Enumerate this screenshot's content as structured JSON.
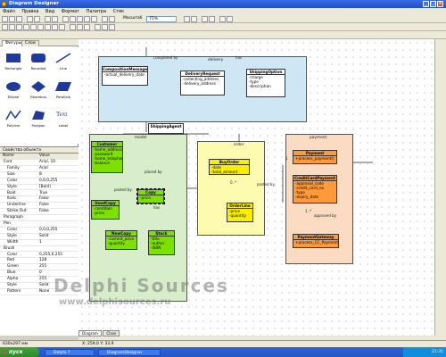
{
  "window": {
    "title": "Diagram Designer"
  },
  "menu": [
    "Файл",
    "Правка",
    "Вид",
    "Формат",
    "Палитра",
    "Стек"
  ],
  "toolbar": {
    "zoom_label": "Масштаб",
    "zoom_value": "75%"
  },
  "panel_tabs": [
    "Фигуры",
    "Слои"
  ],
  "shapes": [
    "Rectangle",
    "Rounded",
    "Line",
    "Ellipse",
    "Rhombus",
    "Parallelo",
    "Polyline",
    "Polygon",
    "Label"
  ],
  "shape_text_glyph": "Text",
  "properties": {
    "title": "Свойства объекта",
    "columns": [
      "Name",
      "Value"
    ],
    "rows": [
      [
        "Font",
        "Arial, 10"
      ],
      [
        "Family",
        "Arial"
      ],
      [
        "Size",
        "8"
      ],
      [
        "Color",
        "0,0,0,255"
      ],
      [
        "Style",
        "[Bold]"
      ],
      [
        "Bold",
        "True"
      ],
      [
        "Italic",
        "False"
      ],
      [
        "Underline",
        "False"
      ],
      [
        "Strike Out",
        "False"
      ],
      [
        "Paragraph",
        ""
      ],
      [
        "Pen",
        ""
      ],
      [
        "Color",
        "0,0,0,255"
      ],
      [
        "Style",
        "Solid"
      ],
      [
        "Width",
        "1"
      ],
      [
        "Brush",
        ""
      ],
      [
        "Color",
        "0,255,0,255"
      ],
      [
        "Red",
        "128"
      ],
      [
        "Green",
        "255"
      ],
      [
        "Blue",
        "0"
      ],
      [
        "Alpha",
        "255"
      ],
      [
        "Style",
        "Solid"
      ],
      [
        "Pattern",
        "None"
      ]
    ]
  },
  "packages": {
    "delivery": "delivery",
    "model": "model",
    "order": "order",
    "payment": "payment"
  },
  "classes": {
    "composition_message": {
      "name": "CompositionMessage",
      "attrs": [
        "-actual_delivery_date"
      ]
    },
    "delivery_request": {
      "name": "DeliveryRequest",
      "attrs": [
        "-collecting_address",
        "-delivery_address"
      ]
    },
    "shipping_option": {
      "name": "ShippingOption",
      "attrs": [
        "-charge",
        "-type",
        "-description"
      ]
    },
    "shipping_agent": {
      "name": "ShippingAgent",
      "attrs": []
    },
    "customer": {
      "name": "Customer",
      "attrs": [
        "-home_address",
        "-password",
        "-home_telephone",
        "-balance"
      ]
    },
    "used_copy": {
      "name": "UsedCopy",
      "attrs": [
        "-condition",
        "-price"
      ]
    },
    "copy": {
      "name": "Copy",
      "attrs": [
        "-price"
      ]
    },
    "new_copy": {
      "name": "NewCopy",
      "attrs": [
        "-current_price",
        "-quantity"
      ]
    },
    "stock": {
      "name": "Stock",
      "attrs": [
        "-title",
        "-author",
        "-ISBN"
      ]
    },
    "buy_order": {
      "name": "BuyOrder",
      "attrs": [
        "-date",
        "-total_amount"
      ]
    },
    "order_line": {
      "name": "OrderLine",
      "attrs": [
        "-price",
        "-quantity"
      ]
    },
    "payment": {
      "name": "Payment",
      "attrs": [
        "+process_payment()"
      ]
    },
    "credit_card_payment": {
      "name": "CreditCardPayment",
      "attrs": [
        "-approval_code",
        "-credit_card_no",
        "-type",
        "-expiry_date"
      ]
    },
    "payment_gateway": {
      "name": "PaymentGateway",
      "attrs": [
        "+process_CC_Payment()"
      ]
    }
  },
  "links": {
    "completed_by": "completed by",
    "has_top": "has",
    "placed_by": "placed by",
    "posted_by": "posted by",
    "has_mid": "has",
    "posted_by2": "posted by",
    "approved_by": "approved by",
    "one": "1",
    "zero_star": "0..*",
    "one_star": "1..*"
  },
  "page_tabs": [
    "Diagram",
    "Class"
  ],
  "status": {
    "left": "630x297 мм",
    "right": "X: 259,0 Y: 33,9"
  },
  "watermark": {
    "line1": "Delphi Sources",
    "line2": "www.delphisources.ru"
  },
  "taskbar": {
    "start": "пуск",
    "tasks": [
      "Delphi 7",
      "DiagramDesigner"
    ],
    "clock": "21:35"
  }
}
